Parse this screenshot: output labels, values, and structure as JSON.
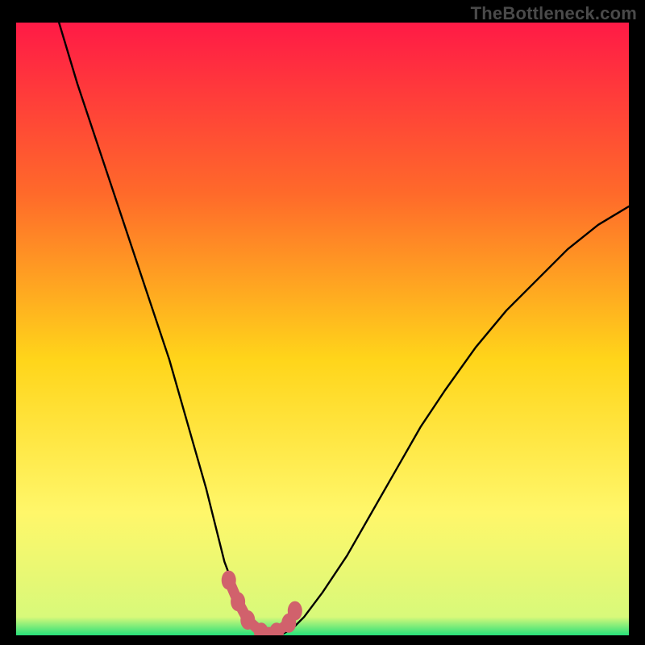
{
  "watermark": "TheBottleneck.com",
  "colors": {
    "frame": "#000000",
    "watermark": "#4a4a4a",
    "curve": "#000000",
    "marker_fill": "#d1616c",
    "marker_stroke": "#d1616c",
    "gradient_top": "#ff1a46",
    "gradient_mid1": "#ff6a2a",
    "gradient_mid2": "#ffd51a",
    "gradient_mid3": "#fff76a",
    "gradient_bottom": "#26e07a"
  },
  "chart_data": {
    "type": "line",
    "title": "",
    "xlabel": "",
    "ylabel": "",
    "xlim": [
      0,
      100
    ],
    "ylim": [
      0,
      100
    ],
    "series": [
      {
        "name": "bottleneck-curve",
        "x": [
          7,
          10,
          13,
          16,
          19,
          22,
          25,
          27,
          29,
          31,
          32.5,
          34,
          35.5,
          37,
          39,
          41,
          43,
          45,
          47,
          50,
          54,
          58,
          62,
          66,
          70,
          75,
          80,
          85,
          90,
          95,
          100
        ],
        "y": [
          100,
          90,
          81,
          72,
          63,
          54,
          45,
          38,
          31,
          24,
          18,
          12,
          8,
          4,
          1,
          0,
          0,
          1,
          3,
          7,
          13,
          20,
          27,
          34,
          40,
          47,
          53,
          58,
          63,
          67,
          70
        ]
      }
    ],
    "markers": {
      "name": "highlight-points",
      "x": [
        34.7,
        36.2,
        37.8,
        40.0,
        42.5,
        44.5,
        45.5
      ],
      "y": [
        9.0,
        5.5,
        2.5,
        0.5,
        0.5,
        2.0,
        4.0
      ]
    }
  }
}
